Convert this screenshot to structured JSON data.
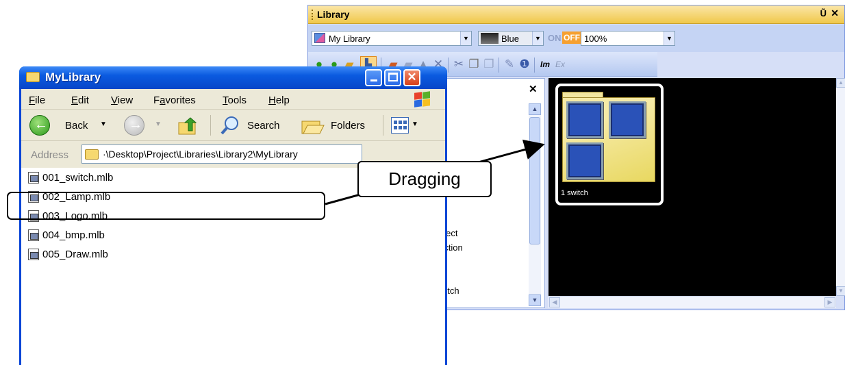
{
  "library": {
    "title": "Library",
    "pin": "Ũ",
    "close": "✕",
    "combo_value": "My Library",
    "color_value": "Blue",
    "on_label": "ON",
    "off_label": "OFF",
    "zoom_value": "100%",
    "left_close": "✕",
    "left_items": [
      "bject",
      "nction",
      "",
      "",
      "witch"
    ],
    "thumb_caption": "1 switch",
    "toolbar_extra": [
      "Im",
      "Ex"
    ]
  },
  "explorer": {
    "title": "MyLibrary",
    "menu": [
      {
        "label": "File",
        "u": "F",
        "rest": "ile"
      },
      {
        "label": "Edit",
        "u": "E",
        "rest": "dit"
      },
      {
        "label": "View",
        "u": "V",
        "rest": "iew"
      },
      {
        "label": "Favorites",
        "pre": "F",
        "u": "a",
        "rest": "vorites"
      },
      {
        "label": "Tools",
        "u": "T",
        "rest": "ools"
      },
      {
        "label": "Help",
        "u": "H",
        "rest": "elp"
      }
    ],
    "back_label": "Back",
    "search_label": "Search",
    "folders_label": "Folders",
    "address_label": "Address",
    "address_value": "·\\Desktop\\Project\\Libraries\\Library2\\MyLibrary",
    "files": [
      "001_switch.mlb",
      "002_Lamp.mlb",
      "003_Logo.mlb",
      "004_bmp.mlb",
      "005_Draw.mlb"
    ]
  },
  "annotation": {
    "callout_text": "Dragging"
  },
  "colors": {
    "xp_title_blue": "#0a5ae0",
    "library_title_gold": "#f0c84a",
    "off_orange": "#f6a030",
    "thumb_square_blue": "#2a52b8"
  }
}
